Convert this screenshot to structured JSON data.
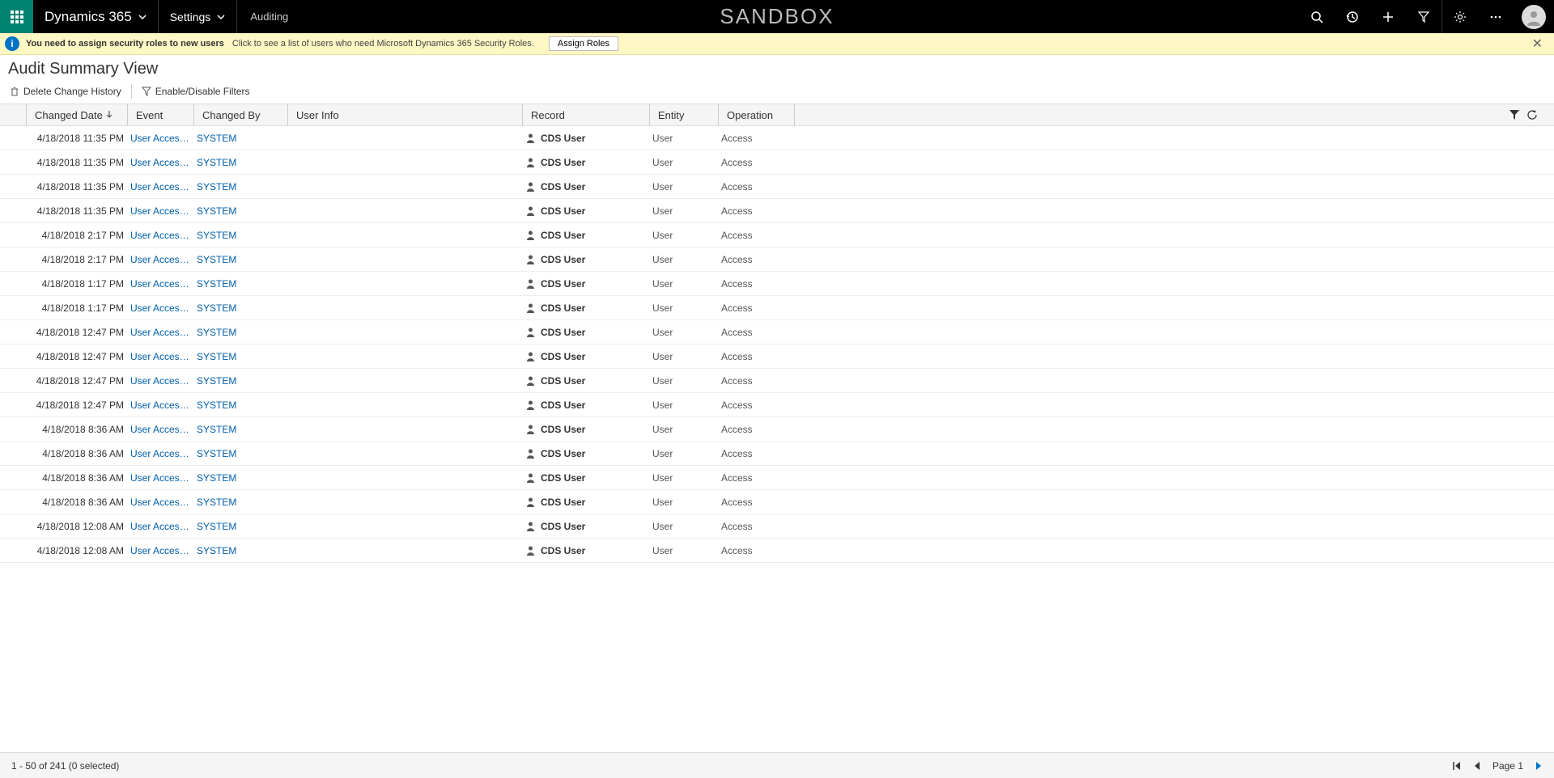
{
  "nav": {
    "brand": "Dynamics 365",
    "menu": "Settings",
    "crumb": "Auditing",
    "sandbox": "SANDBOX"
  },
  "notification": {
    "bold_message": "You need to assign security roles to new users",
    "message": "Click to see a list of users who need Microsoft Dynamics 365 Security Roles.",
    "button": "Assign Roles"
  },
  "page": {
    "title": "Audit Summary View"
  },
  "commands": {
    "delete": "Delete Change History",
    "filter": "Enable/Disable Filters"
  },
  "columns": {
    "changed_date": "Changed Date",
    "event": "Event",
    "changed_by": "Changed By",
    "user_info": "User Info",
    "record": "Record",
    "entity": "Entity",
    "operation": "Operation"
  },
  "rows": [
    {
      "date": "4/18/2018 11:35 PM",
      "event": "User Access v...",
      "by": "SYSTEM",
      "record": "CDS User",
      "entity": "User",
      "op": "Access"
    },
    {
      "date": "4/18/2018 11:35 PM",
      "event": "User Access v...",
      "by": "SYSTEM",
      "record": "CDS User",
      "entity": "User",
      "op": "Access"
    },
    {
      "date": "4/18/2018 11:35 PM",
      "event": "User Access v...",
      "by": "SYSTEM",
      "record": "CDS User",
      "entity": "User",
      "op": "Access"
    },
    {
      "date": "4/18/2018 11:35 PM",
      "event": "User Access v...",
      "by": "SYSTEM",
      "record": "CDS User",
      "entity": "User",
      "op": "Access"
    },
    {
      "date": "4/18/2018 2:17 PM",
      "event": "User Access v...",
      "by": "SYSTEM",
      "record": "CDS User",
      "entity": "User",
      "op": "Access"
    },
    {
      "date": "4/18/2018 2:17 PM",
      "event": "User Access v...",
      "by": "SYSTEM",
      "record": "CDS User",
      "entity": "User",
      "op": "Access"
    },
    {
      "date": "4/18/2018 1:17 PM",
      "event": "User Access v...",
      "by": "SYSTEM",
      "record": "CDS User",
      "entity": "User",
      "op": "Access"
    },
    {
      "date": "4/18/2018 1:17 PM",
      "event": "User Access v...",
      "by": "SYSTEM",
      "record": "CDS User",
      "entity": "User",
      "op": "Access"
    },
    {
      "date": "4/18/2018 12:47 PM",
      "event": "User Access v...",
      "by": "SYSTEM",
      "record": "CDS User",
      "entity": "User",
      "op": "Access"
    },
    {
      "date": "4/18/2018 12:47 PM",
      "event": "User Access v...",
      "by": "SYSTEM",
      "record": "CDS User",
      "entity": "User",
      "op": "Access"
    },
    {
      "date": "4/18/2018 12:47 PM",
      "event": "User Access v...",
      "by": "SYSTEM",
      "record": "CDS User",
      "entity": "User",
      "op": "Access"
    },
    {
      "date": "4/18/2018 12:47 PM",
      "event": "User Access v...",
      "by": "SYSTEM",
      "record": "CDS User",
      "entity": "User",
      "op": "Access"
    },
    {
      "date": "4/18/2018 8:36 AM",
      "event": "User Access v...",
      "by": "SYSTEM",
      "record": "CDS User",
      "entity": "User",
      "op": "Access"
    },
    {
      "date": "4/18/2018 8:36 AM",
      "event": "User Access v...",
      "by": "SYSTEM",
      "record": "CDS User",
      "entity": "User",
      "op": "Access"
    },
    {
      "date": "4/18/2018 8:36 AM",
      "event": "User Access v...",
      "by": "SYSTEM",
      "record": "CDS User",
      "entity": "User",
      "op": "Access"
    },
    {
      "date": "4/18/2018 8:36 AM",
      "event": "User Access v...",
      "by": "SYSTEM",
      "record": "CDS User",
      "entity": "User",
      "op": "Access"
    },
    {
      "date": "4/18/2018 12:08 AM",
      "event": "User Access v...",
      "by": "SYSTEM",
      "record": "CDS User",
      "entity": "User",
      "op": "Access"
    },
    {
      "date": "4/18/2018 12:08 AM",
      "event": "User Access v...",
      "by": "SYSTEM",
      "record": "CDS User",
      "entity": "User",
      "op": "Access"
    }
  ],
  "footer": {
    "status": "1 - 50 of 241 (0 selected)",
    "page_label": "Page 1"
  }
}
